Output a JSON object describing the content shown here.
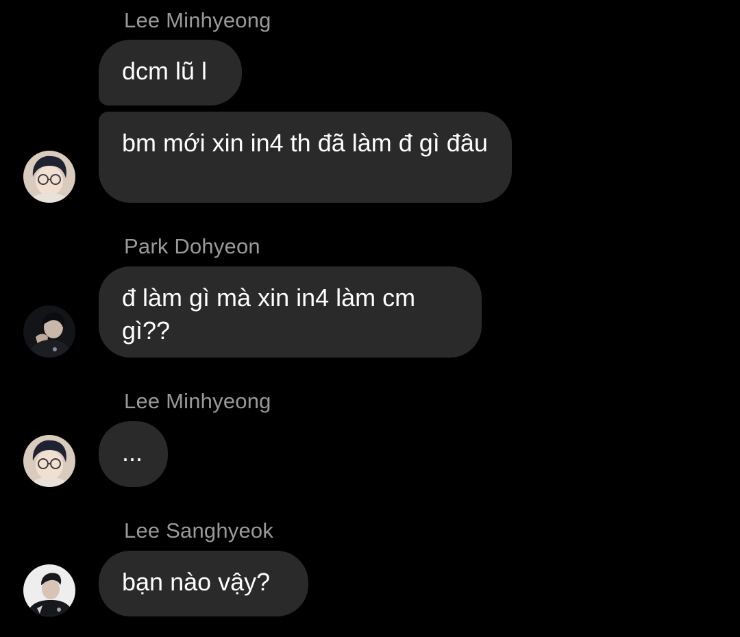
{
  "messages": [
    {
      "sender": "Lee Minhyeong",
      "bubbles": [
        "dcm lũ l",
        "bm mới xin in4 th đã làm đ gì đâu"
      ],
      "avatar_icon": "person-glasses-light-avatar"
    },
    {
      "sender": "Park Dohyeon",
      "bubbles": [
        "đ làm gì mà xin in4 làm cm gì??"
      ],
      "avatar_icon": "person-dark-avatar"
    },
    {
      "sender": "Lee Minhyeong",
      "bubbles": [
        "..."
      ],
      "avatar_icon": "person-glasses-light-avatar"
    },
    {
      "sender": "Lee Sanghyeok",
      "bubbles": [
        "bạn nào vậy?"
      ],
      "avatar_icon": "person-white-bg-avatar"
    }
  ],
  "colors": {
    "background": "#000000",
    "bubble": "#2a2a2a",
    "sender_text": "#9a9a9a",
    "message_text": "#ffffff"
  }
}
